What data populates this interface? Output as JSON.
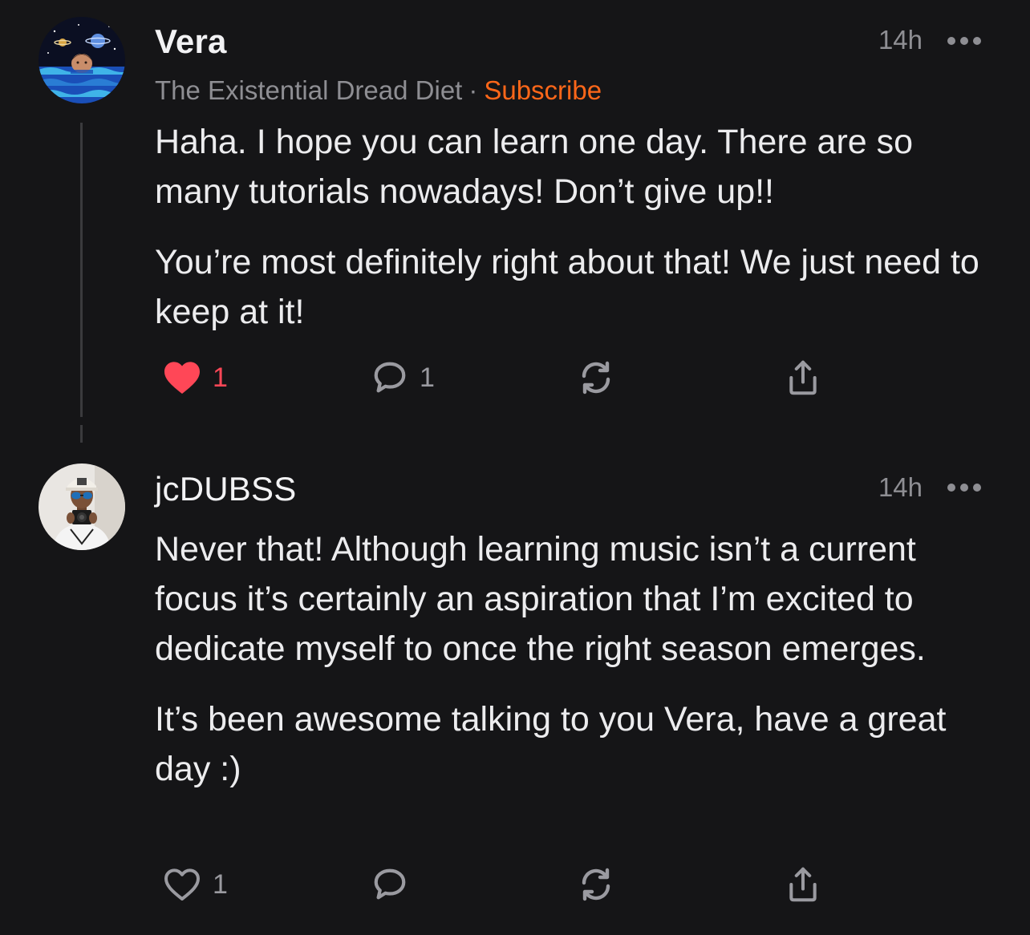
{
  "comments": [
    {
      "author": "Vera",
      "publication": "The Existential Dread Diet",
      "separator": "·",
      "subscribe_label": "Subscribe",
      "time": "14h",
      "paragraphs": [
        "Haha. I hope you can learn one day. There are so many tutorials nowadays! Don’t give up!!",
        "You’re most definitely right about that! We just need to keep at it!"
      ],
      "likes": "1",
      "liked": true,
      "replies": "1",
      "like_icon": "heart-filled-icon",
      "reply_icon": "comment-bubble-icon",
      "restack_icon": "restack-icon",
      "share_icon": "share-icon"
    },
    {
      "author": "jcDUBSS",
      "time": "14h",
      "paragraphs": [
        "Never that! Although learning music isn’t a current focus it’s certainly an aspiration that I’m excited to dedicate myself to once the right season emerges.",
        "It’s been awesome talking to you Vera, have a great day :)"
      ],
      "likes": "1",
      "liked": false,
      "like_icon": "heart-outline-icon",
      "reply_icon": "comment-bubble-icon",
      "restack_icon": "restack-icon",
      "share_icon": "share-icon"
    }
  ],
  "colors": {
    "background": "#151517",
    "accent_subscribe": "#ff6719",
    "liked": "#ff4757",
    "muted": "#8e8e93"
  }
}
